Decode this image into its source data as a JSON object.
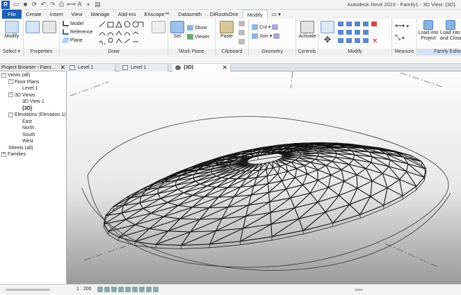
{
  "app": {
    "icon_letter": "R",
    "window_title": "Autodesk Revit 2023 - Family1 - 3D View: {3D}"
  },
  "tabs": [
    "File",
    "Create",
    "Insert",
    "View",
    "Manage",
    "Add-Ins",
    "Enscape™",
    "Datasmith",
    "DiRootsOne",
    "Modify",
    "▭ ▾"
  ],
  "ribbon": {
    "select": {
      "button": "Modify",
      "label": "Select ▾"
    },
    "properties": {
      "label": "Properties"
    },
    "draw": {
      "model": "Model",
      "reference": "Reference",
      "plane": "Plane",
      "label": "Draw"
    },
    "work_plane": {
      "set": "Set",
      "show": "Show",
      "viewer": "Viewer",
      "label": "Work Plane"
    },
    "clipboard": {
      "paste": "Paste",
      "label": "Clipboard"
    },
    "geometry": {
      "cut": "Cut",
      "join": "Join",
      "label": "Geometry"
    },
    "controls": {
      "activate": "Activate",
      "label": "Controls"
    },
    "modify": {
      "label": "Modify"
    },
    "measure": {
      "label": "Measure"
    },
    "family_editor": {
      "load_into_project": "Load into Project",
      "load_into_project_and_close": "Load into Project and Close",
      "label": "Family Editor"
    }
  },
  "browser": {
    "title": "Project Browser - Fami...",
    "tree": [
      {
        "label": "Views (all)",
        "level": 0,
        "toggle": "−"
      },
      {
        "label": "Floor Plans",
        "level": 1,
        "toggle": "−"
      },
      {
        "label": "Level 1",
        "level": 3,
        "toggle": ""
      },
      {
        "label": "3D Views",
        "level": 1,
        "toggle": "−"
      },
      {
        "label": "3D View 1",
        "level": 3,
        "toggle": ""
      },
      {
        "label": "{3D}",
        "level": 3,
        "toggle": "",
        "bold": true
      },
      {
        "label": "Elevations (Elevation 1)",
        "level": 1,
        "toggle": "−"
      },
      {
        "label": "East",
        "level": 3,
        "toggle": ""
      },
      {
        "label": "North",
        "level": 3,
        "toggle": ""
      },
      {
        "label": "South",
        "level": 3,
        "toggle": ""
      },
      {
        "label": "West",
        "level": 3,
        "toggle": ""
      },
      {
        "label": "Sheets (all)",
        "level": 1,
        "toggle": ""
      },
      {
        "label": "Families",
        "level": 0,
        "toggle": "+"
      }
    ]
  },
  "doc_tabs": [
    {
      "label": "Level 1",
      "active": false
    },
    {
      "label": "Level 1",
      "active": false
    },
    {
      "label": "{3D}",
      "active": true
    }
  ],
  "status": {
    "scale": "1 : 200"
  },
  "colors": {
    "file_tab": "#1d60b3",
    "accent": "#1d60b3"
  }
}
